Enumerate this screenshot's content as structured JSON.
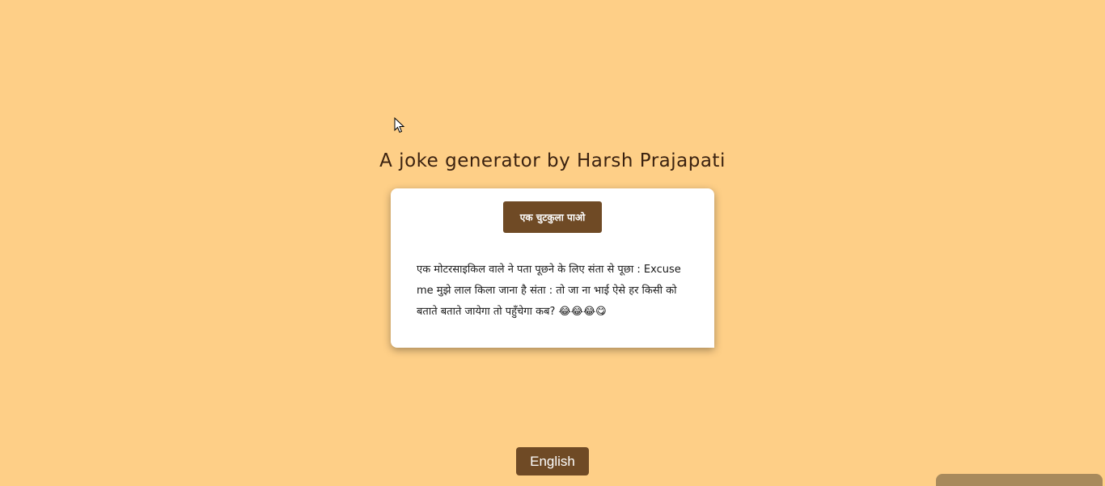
{
  "header": {
    "title": "A joke generator by Harsh Prajapati"
  },
  "card": {
    "button_label": "एक चुटकुला पाओ",
    "joke": "एक मोटरसाइकिल वाले ने पता पूछने के लिए संता से पूछा : Excuse me मुझे लाल किला जाना है संता : तो जा ना भाई ऐसे हर किसी को बताते बताते जायेगा तो पहुँचेगा कब? 😂😂😂😋"
  },
  "footer": {
    "language_button_label": "English"
  },
  "colors": {
    "background": "#fecf87",
    "button": "#6f4a25",
    "card": "#ffffff"
  },
  "icons": {
    "cursor": "mouse-pointer-icon"
  }
}
